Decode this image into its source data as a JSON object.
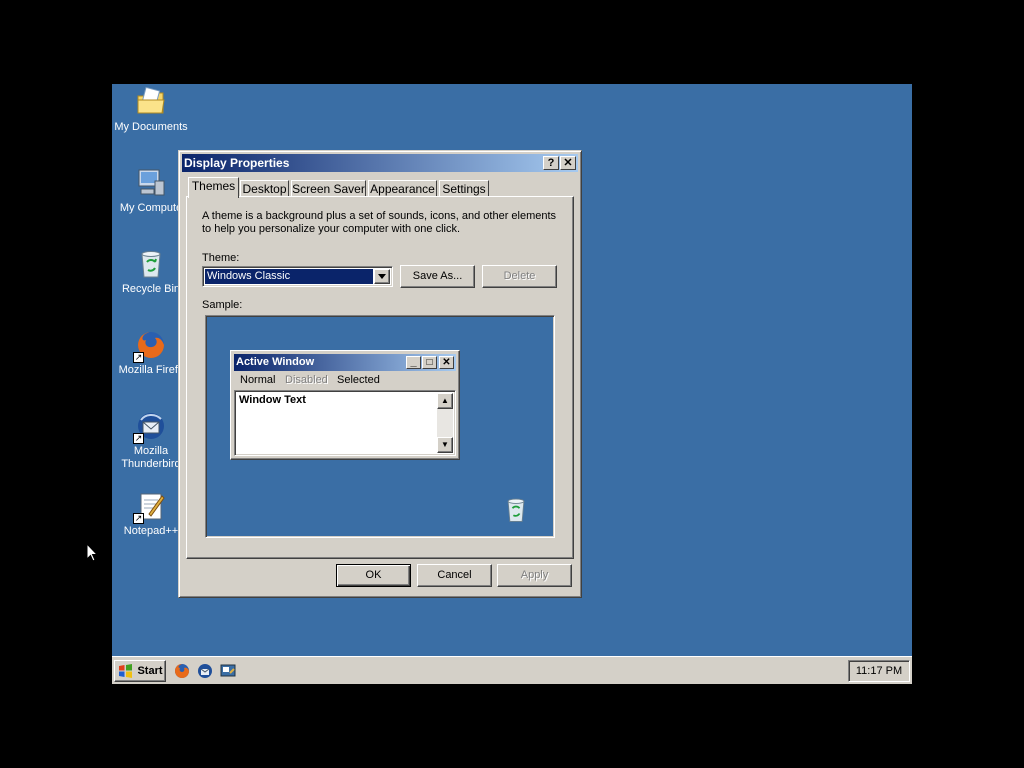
{
  "desktop": {
    "icons": [
      {
        "label": "My Documents",
        "icon": "folder-documents-icon"
      },
      {
        "label": "My Compute",
        "icon": "computer-icon"
      },
      {
        "label": "Recycle Bin",
        "icon": "recycle-bin-icon"
      },
      {
        "label": "Mozilla Firefc",
        "icon": "firefox-icon"
      },
      {
        "label": "Mozilla\nThunderbird",
        "icon": "thunderbird-icon"
      },
      {
        "label": "Notepad++",
        "icon": "notepad-icon"
      }
    ]
  },
  "dialog": {
    "title": "Display Properties",
    "help_btn": "?",
    "close_btn": "✕",
    "tabs": [
      {
        "label": "Themes",
        "active": true
      },
      {
        "label": "Desktop"
      },
      {
        "label": "Screen Saver"
      },
      {
        "label": "Appearance"
      },
      {
        "label": "Settings"
      }
    ],
    "description": "A theme is a background plus a set of sounds, icons, and other elements to help you personalize your computer with one click.",
    "theme_label": "Theme:",
    "theme_value": "Windows Classic",
    "save_as": "Save As...",
    "delete": "Delete",
    "sample_label": "Sample:",
    "sample": {
      "window_title": "Active Window",
      "menu_normal": "Normal",
      "menu_disabled": "Disabled",
      "menu_selected": "Selected",
      "window_text": "Window Text"
    },
    "ok": "OK",
    "cancel": "Cancel",
    "apply": "Apply"
  },
  "taskbar": {
    "start_label": "Start",
    "clock": "11:17 PM"
  },
  "colors": {
    "desktop": "#3a6ea5",
    "face": "#d4d0c8",
    "title_active": "#0a246a"
  }
}
